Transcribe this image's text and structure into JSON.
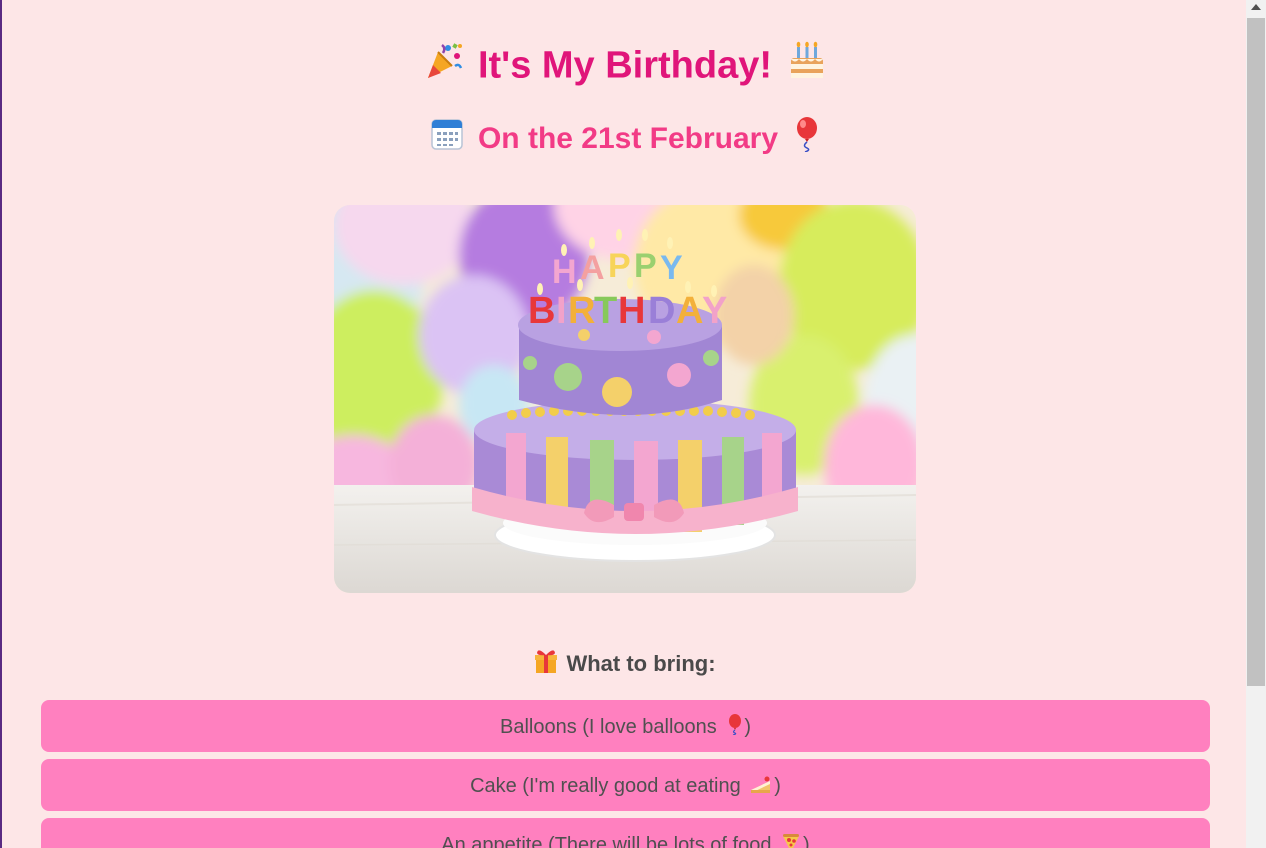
{
  "header": {
    "title": "It's My Birthday!",
    "date": "On the 21st February"
  },
  "icons": {
    "title_left": "party-popper-icon",
    "title_right": "birthday-cake-icon",
    "date_left": "calendar-icon",
    "date_right": "balloon-icon",
    "bring_title": "gift-icon"
  },
  "hero": {
    "cake_topper": "HAPPY BIRTHDAY"
  },
  "bring": {
    "title": "What to bring:",
    "items": [
      {
        "text": "Balloons (I love balloons",
        "icon": "balloon-icon",
        "close": ")"
      },
      {
        "text": "Cake (I'm really good at eating",
        "icon": "cake-slice-icon",
        "close": ")"
      },
      {
        "text": "An appetite (There will be lots of food",
        "icon": "pizza-icon",
        "close": ")"
      }
    ]
  },
  "colors": {
    "background": "#fde6e7",
    "title": "#e0157a",
    "subtitle": "#f23b86",
    "item_background": "#ff80bf",
    "item_text": "#505050"
  }
}
